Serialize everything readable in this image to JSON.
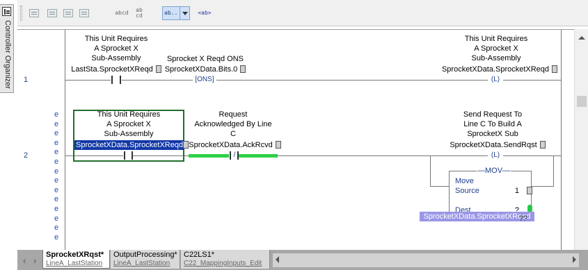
{
  "organizer": {
    "label": "Controller Organizer"
  },
  "toolbar": {
    "buttons": [
      "abcd",
      "ab\ncd",
      "ab..",
      "<ab>"
    ]
  },
  "rungs": [
    {
      "number": "1",
      "contact1": {
        "description": [
          "This Unit Requires",
          "A Sprocket X",
          "Sub-Assembly"
        ],
        "tag": "LastSta.SprocketXReqd"
      },
      "ons": {
        "description": "Sprocket X Reqd ONS",
        "tag": "SprocketXData.Bits.0",
        "symbol": "ONS"
      },
      "coil": {
        "description": [
          "This Unit Requires",
          "A Sprocket X",
          "Sub-Assembly"
        ],
        "tag": "SprocketXData.SprocketXReqd",
        "symbol": "L"
      }
    },
    {
      "number": "2",
      "markers": [
        "e",
        "e",
        "e",
        "e",
        "e",
        "e",
        "e",
        "e",
        "e",
        "e",
        "e",
        "e",
        "e",
        "e"
      ],
      "contact1": {
        "description": [
          "This Unit Requires",
          "A Sprocket X",
          "Sub-Assembly"
        ],
        "tag": "SprocketXData.SprocketXReqd"
      },
      "contact2": {
        "description": [
          "Request",
          "Acknowledged By Line",
          "C"
        ],
        "tag": "SprocketXData.AckRcvd",
        "symbol": "/"
      },
      "coil": {
        "description": [
          "Send Request To",
          "Line C To Build A",
          "SprocketX Sub",
          ""
        ],
        "tag": "SprocketXData.SendRqst",
        "symbol": "L"
      },
      "mov": {
        "title": "MOV",
        "name": "Move",
        "source_label": "Source",
        "source_value": "1",
        "dest_label": "Dest",
        "dest_value": "?",
        "dest_value2": "??",
        "dest_tag": "SprocketXData.SprocketXReqd"
      }
    }
  ],
  "tabs": [
    {
      "title": "SprocketXRqst*",
      "sub": "LineA_LastStation",
      "active": true
    },
    {
      "title": "OutputProcessing*",
      "sub": "LineA_LastStation",
      "active": false
    },
    {
      "title": "C22LS1*",
      "sub": "C22_MappingInputs_Edit",
      "active": false
    }
  ],
  "colors": {
    "selection_bg": "#1238a8",
    "edit_green": "#2fd24a",
    "dest_tag_bg": "#9a96e6",
    "instruction_text": "#1f3f8a"
  }
}
